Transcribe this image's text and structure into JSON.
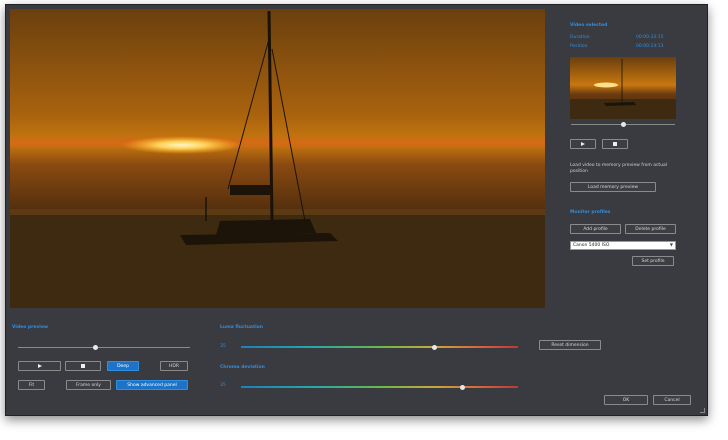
{
  "video_preview": {
    "heading": "Video preview",
    "play_icon": "play-icon",
    "stop_icon": "stop-icon",
    "deep_label": "Deep",
    "hdr_label": "HDR",
    "fit_label": "Fit",
    "frame_only_label": "Frame only",
    "show_advanced_label": "Show advanced panel",
    "position": 0.45
  },
  "video_sync": {
    "heading": "Video selected",
    "duration_label": "Duration",
    "duration_value": "00:00:33:15",
    "position_label": "Position",
    "position_value": "00:00:14:13",
    "scrub_position": 0.5,
    "play_icon": "play-icon",
    "stop_icon": "stop-icon",
    "load_info": "Load video to memory preview from actual position",
    "load_button": "Load memory preview"
  },
  "monitor_profiles": {
    "heading": "Monitor profiles",
    "add_label": "Add profile",
    "remove_label": "Delete profile",
    "selected": "Canon 5400 ISO",
    "set_label": "Set profile"
  },
  "luma": {
    "heading": "Luma fluctuation",
    "value_label": "35",
    "level": 0.7,
    "reset_label": "Reset dimension"
  },
  "chroma": {
    "heading": "Chroma deviation",
    "value_label": "35",
    "level": 0.8
  },
  "dialog": {
    "ok_label": "OK",
    "cancel_label": "Cancel"
  },
  "colors": {
    "accent": "#2f8fe0",
    "background": "#3a3b40",
    "sunset": "#c8780f"
  }
}
